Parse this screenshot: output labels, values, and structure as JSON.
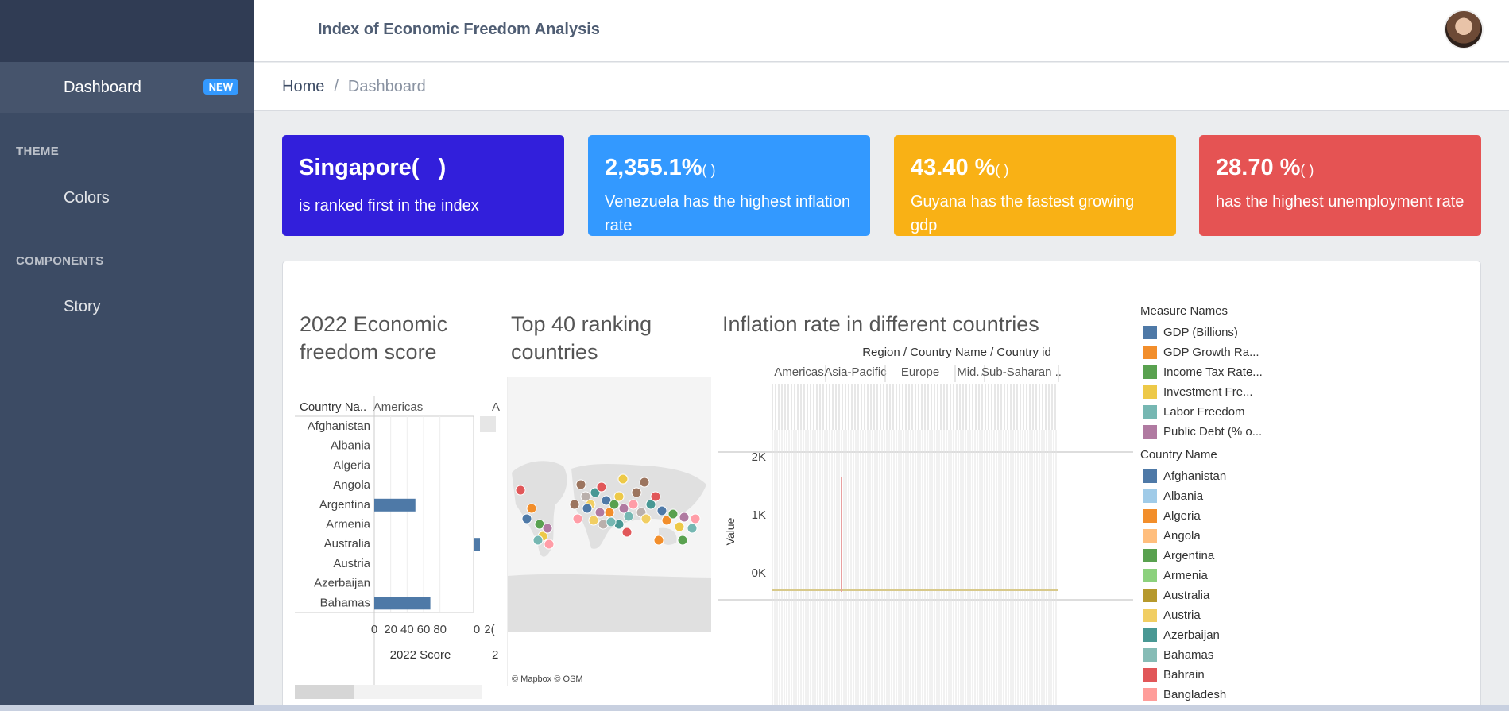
{
  "header": {
    "title": "Index of Economic Freedom Analysis"
  },
  "sidebar": {
    "items": [
      {
        "label": "Dashboard",
        "badge": "NEW"
      }
    ],
    "sections": [
      {
        "title": "THEME",
        "items": [
          {
            "label": "Colors"
          }
        ]
      },
      {
        "title": "COMPONENTS",
        "items": [
          {
            "label": "Story"
          }
        ]
      }
    ]
  },
  "breadcrumb": {
    "home": "Home",
    "separator": "/",
    "current": "Dashboard"
  },
  "cards": [
    {
      "big": "Singapore(",
      "big_suffix": ")",
      "sub": "is ranked first in the index",
      "color": "#321fdb"
    },
    {
      "big": "2,355.1%",
      "big_suffix": "(   )",
      "sub": "Venezuela has the highest inflation rate",
      "color": "#3399ff"
    },
    {
      "big": "43.40 %",
      "big_suffix": "(   )",
      "sub": "Guyana has the fastest growing gdp",
      "color": "#f9b115"
    },
    {
      "big": "28.70 %",
      "big_suffix": "(   )",
      "sub": "has the highest unemployment rate",
      "color": "#e55353"
    }
  ],
  "viz1": {
    "title_line1": "2022 Economic",
    "title_line2": "freedom score",
    "col_header": "Country Na..",
    "region_header": "Americas",
    "region_header_2": "A",
    "axis_label": "2022 Score",
    "axis_label_2": "2",
    "ticks": [
      "0",
      "20",
      "40",
      "60",
      "80",
      "0",
      "2("
    ],
    "chart_data": {
      "type": "bar",
      "categories": [
        "Afghanistan",
        "Albania",
        "Algeria",
        "Angola",
        "Argentina",
        "Armenia",
        "Australia",
        "Austria",
        "Azerbaijan",
        "Bahamas"
      ],
      "values": [
        null,
        null,
        null,
        null,
        50.1,
        null,
        77.0,
        null,
        null,
        68.3
      ],
      "xlabel": "2022 Score",
      "xlim": [
        0,
        90
      ]
    }
  },
  "viz2": {
    "title_line1": "Top 40 ranking",
    "title_line2": "countries",
    "attribution": "© Mapbox  © OSM"
  },
  "viz3": {
    "title": "Inflation rate in different countries",
    "header": "Region / Country Name / Country id",
    "regions": [
      "Americas",
      "Asia-Pacific",
      "Europe",
      "Mid..",
      "Sub-Saharan .."
    ],
    "yaxis_label": "Value",
    "yticks": [
      "2K",
      "1K",
      "0K"
    ]
  },
  "legend": {
    "measure_title": "Measure Names",
    "measures": [
      {
        "label": "GDP (Billions)",
        "color": "#4e79a7"
      },
      {
        "label": "GDP Growth Ra...",
        "color": "#f28e2b"
      },
      {
        "label": "Income Tax Rate...",
        "color": "#59a14f"
      },
      {
        "label": "Investment Fre...",
        "color": "#edc948"
      },
      {
        "label": "Labor Freedom",
        "color": "#76b7b2"
      },
      {
        "label": "Public Debt (% o...",
        "color": "#b07aa1"
      }
    ],
    "country_title": "Country Name",
    "countries": [
      {
        "label": "Afghanistan",
        "color": "#4e79a7"
      },
      {
        "label": "Albania",
        "color": "#a0cbe8"
      },
      {
        "label": "Algeria",
        "color": "#f28e2b"
      },
      {
        "label": "Angola",
        "color": "#ffbe7d"
      },
      {
        "label": "Argentina",
        "color": "#59a14f"
      },
      {
        "label": "Armenia",
        "color": "#8cd17d"
      },
      {
        "label": "Australia",
        "color": "#b6992d"
      },
      {
        "label": "Austria",
        "color": "#f1ce63"
      },
      {
        "label": "Azerbaijan",
        "color": "#499894"
      },
      {
        "label": "Bahamas",
        "color": "#86bcb6"
      },
      {
        "label": "Bahrain",
        "color": "#e15759"
      },
      {
        "label": "Bangladesh",
        "color": "#ff9d9a"
      }
    ]
  }
}
